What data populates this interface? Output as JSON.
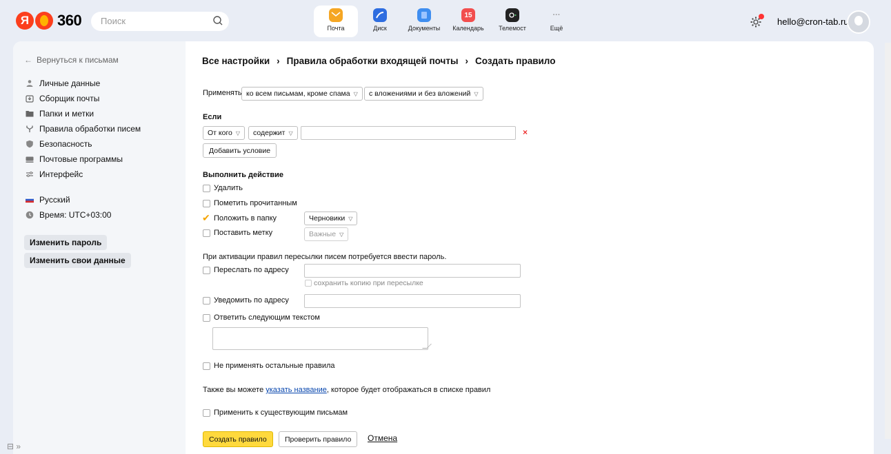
{
  "topbar": {
    "logo_text": "360",
    "logo_ya": "Я",
    "search_placeholder": "Поиск",
    "apps": [
      {
        "label": "Почта",
        "icon": "mail-icon",
        "color": "#f5a623"
      },
      {
        "label": "Диск",
        "icon": "disk-icon",
        "color": "#2e6de0"
      },
      {
        "label": "Документы",
        "icon": "documents-icon",
        "color": "#3f8ef0"
      },
      {
        "label": "Календарь",
        "icon": "calendar-icon",
        "color": "#f24e4e",
        "badge": "15"
      },
      {
        "label": "Телемост",
        "icon": "telemost-icon",
        "color": "#222222"
      },
      {
        "label": "Ещё",
        "icon": "more-icon",
        "color": "#999999",
        "glyph": "···"
      }
    ],
    "user_email": "hello@cron-tab.ru"
  },
  "sidebar": {
    "back_label": "Вернуться к письмам",
    "items": [
      {
        "label": "Личные данные",
        "icon": "person-icon"
      },
      {
        "label": "Сборщик почты",
        "icon": "collector-icon"
      },
      {
        "label": "Папки и метки",
        "icon": "folder-icon"
      },
      {
        "label": "Правила обработки писем",
        "icon": "rules-icon"
      },
      {
        "label": "Безопасность",
        "icon": "shield-icon"
      },
      {
        "label": "Почтовые программы",
        "icon": "mail-programs-icon"
      },
      {
        "label": "Интерфейс",
        "icon": "interface-icon"
      }
    ],
    "language": "Русский",
    "time": "Время: UTC+03:00",
    "change_password": "Изменить пароль",
    "change_data": "Изменить свои данные"
  },
  "breadcrumbs": {
    "root": "Все настройки",
    "section": "Правила обработки входящей почты",
    "current": "Создать правило",
    "separator": "›"
  },
  "apply": {
    "label": "Применять",
    "scope": "ко всем письмам, кроме спама",
    "attachments": "с вложениями и без вложений"
  },
  "condition": {
    "heading": "Если",
    "field": "От кого",
    "operator": "содержит",
    "value": "",
    "remove": "×",
    "add_label": "Добавить условие"
  },
  "actions": {
    "heading": "Выполнить действие",
    "delete": "Удалить",
    "mark_read": "Пометить прочитанным",
    "move_to_folder": "Положить в папку",
    "folder_value": "Черновики",
    "set_label": "Поставить метку",
    "label_value": "Важные",
    "password_note": "При активации правил пересылки писем потребуется ввести пароль.",
    "forward": "Переслать по адресу",
    "keep_copy": "сохранить копию при пересылке",
    "notify": "Уведомить по адресу",
    "reply": "Ответить следующим текстом",
    "dont_apply_others": "Не применять остальные правила",
    "name_note_pre": "Также вы можете ",
    "name_note_link": "указать название",
    "name_note_post": ", которое будет отображаться в списке правил",
    "apply_existing": "Применить к существующим письмам"
  },
  "buttons": {
    "create": "Создать правило",
    "check": "Проверить правило",
    "cancel": "Отмена"
  },
  "colors": {
    "accent_yellow": "#ffd93d",
    "check_orange": "#f5a400",
    "link_blue": "#0645ad",
    "remove_red": "#e33333"
  }
}
